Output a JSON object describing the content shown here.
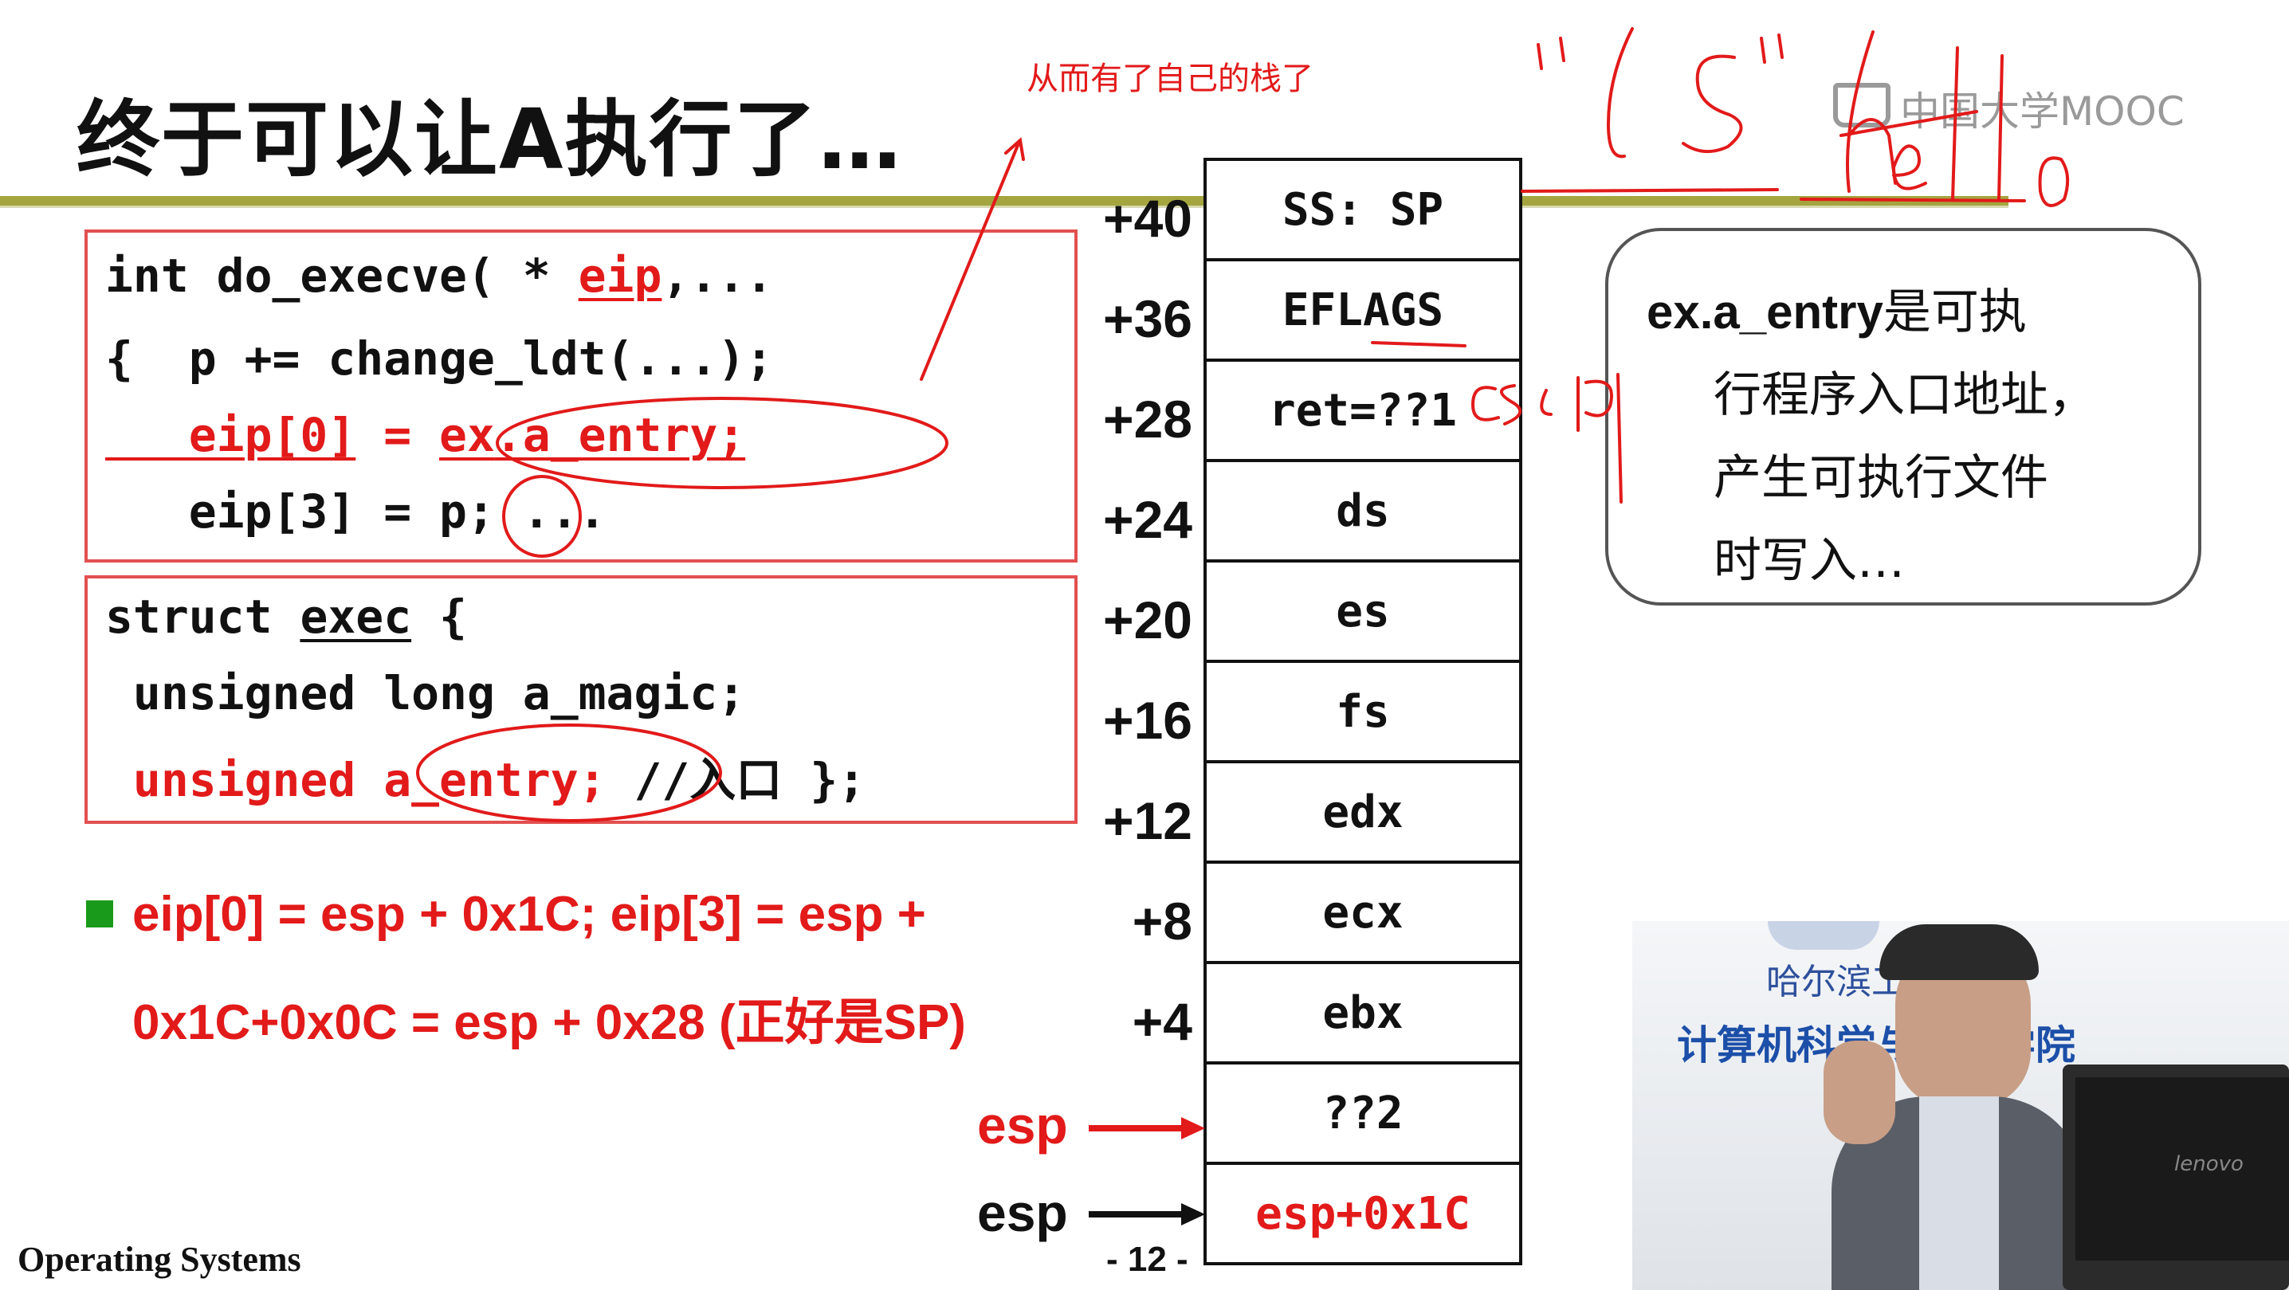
{
  "slide": {
    "title": "终于可以让A执行了…",
    "logo": "中国大学MOOC",
    "footer": "Operating Systems",
    "page": "- 12 -"
  },
  "annotation": {
    "top_note": "从而有了自己的栈了"
  },
  "code_box1": {
    "line1_pre": "int do_execve( * ",
    "line1_red": "eip",
    "line1_post": ",...",
    "line2": "{  p += change_ldt(...);",
    "line3_a": "   eip[0]",
    "line3_b": " = ",
    "line3_c": "ex",
    "line3_d": ".a_entry;",
    "line4": "   eip[3] = p; ..."
  },
  "code_box2": {
    "line1_pre": "struct ",
    "line1_u": "exec",
    "line1_post": " {",
    "line2": " unsigned long a_magic;",
    "line3_red": " unsigned a_entry;",
    "line3_post": " //入口 };"
  },
  "bullet": {
    "line1": "eip[0] = esp + 0x1C; eip[3] = esp +",
    "line2": "0x1C+0x0C = esp + 0x28 (正好是SP)"
  },
  "stack": {
    "cells": [
      {
        "offset": "+40",
        "label": "SS: SP"
      },
      {
        "offset": "+36",
        "label": "EFLAGS"
      },
      {
        "offset": "+28",
        "label": "ret=??1"
      },
      {
        "offset": "+24",
        "label": "ds"
      },
      {
        "offset": "+20",
        "label": "es"
      },
      {
        "offset": "+16",
        "label": "fs"
      },
      {
        "offset": "+12",
        "label": "edx"
      },
      {
        "offset": "+8",
        "label": "ecx"
      },
      {
        "offset": "+4",
        "label": "ebx"
      },
      {
        "offset": "",
        "label": "??2"
      },
      {
        "offset": "",
        "label": "esp+0x1C"
      }
    ],
    "esp_red": "esp",
    "esp_black": "esp"
  },
  "callout": {
    "bold": "ex.a_entry",
    "rest1": "是可执",
    "line2": "行程序入口地址，",
    "line3": "产生可执行文件",
    "line4": "时写入…"
  },
  "video": {
    "school": "哈尔滨工业大学",
    "dept": "计算机科学与技术学院",
    "monitor_brand": "lenovo"
  },
  "colors": {
    "accent_red": "#e21a1a",
    "rule_olive": "#a4a53f",
    "bullet_green": "#1a9a1a"
  }
}
